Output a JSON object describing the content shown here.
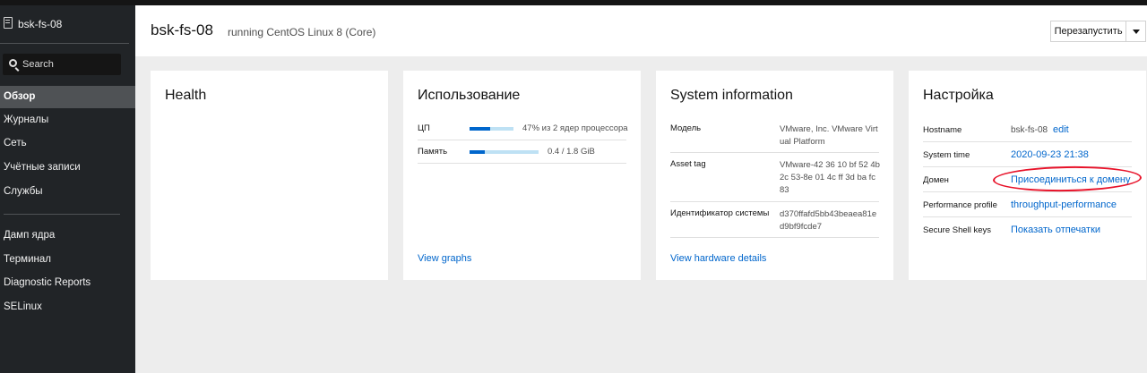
{
  "sidebar": {
    "host": "bsk-fs-08",
    "search_placeholder": "Search",
    "items": [
      {
        "label": "Обзор"
      },
      {
        "label": "Журналы"
      },
      {
        "label": "Сеть"
      },
      {
        "label": "Учётные записи"
      },
      {
        "label": "Службы"
      },
      {
        "label": "Дамп ядра"
      },
      {
        "label": "Терминал"
      },
      {
        "label": "Diagnostic Reports"
      },
      {
        "label": "SELinux"
      }
    ]
  },
  "header": {
    "title": "bsk-fs-08",
    "subtitle": "running CentOS Linux 8 (Core)",
    "restart_label": "Перезапустить"
  },
  "health": {
    "title": "Health"
  },
  "usage": {
    "title": "Использование",
    "cpu": {
      "label": "ЦП",
      "value_text": "47% из 2 ядер процессора",
      "fraction": 0.47
    },
    "memory": {
      "label": "Память",
      "value_text": "0.4 / 1.8 GiB",
      "fraction": 0.22
    },
    "link": "View graphs"
  },
  "system": {
    "title": "System information",
    "model": {
      "label": "Модель",
      "value": "VMware, Inc. VMware Virtual Platform"
    },
    "asset": {
      "label": "Asset tag",
      "value": "VMware-42 36 10 bf 52 4b 2c 53-8e 01 4c ff 3d ba fc 83"
    },
    "sysid": {
      "label": "Идентификатор системы",
      "value": "d370ffafd5bb43beaea81ed9bf9fcde7"
    },
    "link": "View hardware details"
  },
  "config": {
    "title": "Настройка",
    "hostname": {
      "label": "Hostname",
      "value": "bsk-fs-08",
      "edit": "edit"
    },
    "time": {
      "label": "System time",
      "value": "2020-09-23 21:38"
    },
    "domain": {
      "label": "Домен",
      "value": "Присоединиться к домену"
    },
    "perf": {
      "label": "Performance profile",
      "value": "throughput-performance"
    },
    "ssh": {
      "label": "Secure Shell keys",
      "value": "Показать отпечатки"
    }
  },
  "colors": {
    "accent": "#0066cc",
    "annotation": "#e8132a",
    "sidebar": "#212427"
  }
}
